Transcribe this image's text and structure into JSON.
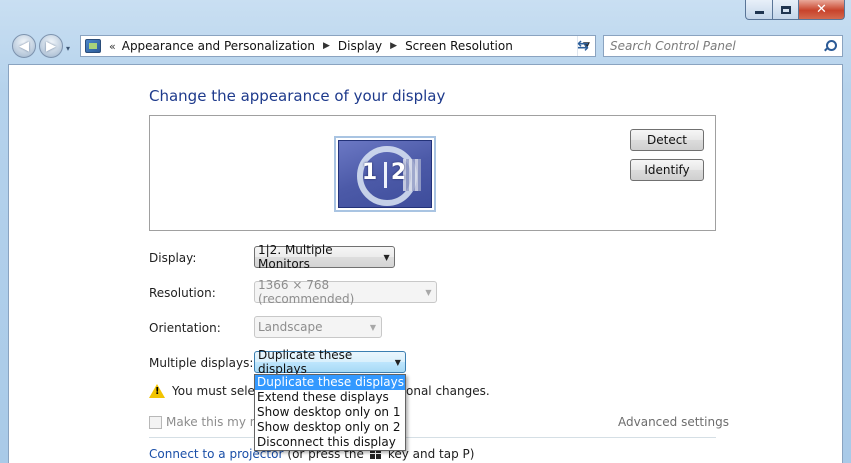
{
  "window": {
    "caption": {
      "minimize_icon": "minimize-icon",
      "maximize_icon": "maximize-icon",
      "close_glyph": "✕"
    }
  },
  "navigation": {
    "back_glyph": "◀",
    "forward_glyph": "▶",
    "history_glyph": "▾",
    "address": {
      "separator": "«",
      "crumbs": [
        "Appearance and Personalization",
        "Display",
        "Screen Resolution"
      ],
      "arrow": "▶",
      "dropdown_glyph": "▼"
    },
    "refresh_glyph": "⇆",
    "search_placeholder": "Search Control Panel"
  },
  "page": {
    "title": "Change the appearance of your display",
    "monitor_label_1": "1",
    "monitor_label_2": "2",
    "detect_label": "Detect",
    "identify_label": "Identify",
    "fields": {
      "display_label": "Display:",
      "display_value": "1|2. Multiple Monitors",
      "resolution_label": "Resolution:",
      "resolution_value": "1366 × 768 (recommended)",
      "orientation_label": "Orientation:",
      "orientation_value": "Landscape",
      "multiple_label": "Multiple displays:",
      "multiple_value": "Duplicate these displays"
    },
    "combo_arrow": "▼",
    "warning_prefix": "You must selec",
    "warning_suffix": "onal changes.",
    "checkbox_label": "Make this my ma",
    "advanced_settings": "Advanced settings",
    "projector_link": "Connect to a projector",
    "projector_text_a": "(or press the",
    "projector_text_b": "key and tap P)"
  },
  "dropdown": {
    "options": [
      "Duplicate these displays",
      "Extend these displays",
      "Show desktop only on 1",
      "Show desktop only on 2",
      "Disconnect this display"
    ],
    "selected_index": 0
  },
  "colors": {
    "title": "#1e3a8c",
    "link": "#1a4fa8",
    "selection": "#3399ff",
    "frame": "#b5d2ec"
  }
}
